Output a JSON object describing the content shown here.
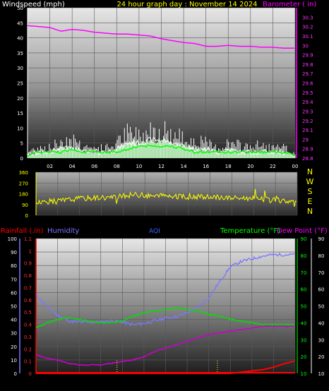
{
  "title": "24 hour graph day : November 14 2024",
  "colors": {
    "background": "#000000",
    "windspeed": "#ffffff",
    "windgust": "#ffffff",
    "wind_avg": "#00ff00",
    "wind_fill": "#bfffbf",
    "barometer": "#ff00ff",
    "direction": "#ffff00",
    "rainfall": "#ff0000",
    "humidity": "#7878ff",
    "temperature": "#00e000",
    "dewpoint": "#cc00cc",
    "aqi": "#0000ff",
    "grid": "#5a5a5a",
    "grid_label_white": "#ffffff",
    "grid_label_green": "#00ff00"
  },
  "labels": {
    "windspeed": "Windspeed (mph)",
    "barometer": "Barometer ( in)",
    "rainfall": "Rainfall (.in)",
    "humidity": "Humidity",
    "aqi": "AQI",
    "temperature": "Temperature (°F)",
    "dewpoint": "Dew Point (°F)"
  },
  "x_ticks": [
    "02",
    "04",
    "06",
    "08",
    "10",
    "12",
    "14",
    "16",
    "18",
    "20",
    "22",
    "00"
  ],
  "chart_data": [
    {
      "type": "line",
      "title": "24 hour graph day : November 14 2024",
      "xlabel": "",
      "x_ticks": [
        "02",
        "04",
        "06",
        "08",
        "10",
        "12",
        "14",
        "16",
        "18",
        "20",
        "22",
        "00"
      ],
      "left_axis": {
        "label": "Windspeed (mph)",
        "range": [
          0,
          50
        ],
        "ticks": [
          0,
          5,
          10,
          15,
          20,
          25,
          30,
          35,
          40,
          45,
          50
        ]
      },
      "right_axis": {
        "label": "Barometer ( in)",
        "range": [
          28.8,
          30.4
        ],
        "ticks": [
          "28.8",
          "28.9",
          "29",
          "29.1",
          "29.2",
          "29.3",
          "29.4",
          "29.5",
          "29.6",
          "29.7",
          "29.8",
          "29.9",
          "30",
          "30.1",
          "30.2",
          "30.3"
        ]
      },
      "series": [
        {
          "name": "Barometer",
          "axis": "right",
          "x": [
            0,
            1,
            2,
            3,
            4,
            5,
            6,
            7,
            8,
            9,
            10,
            11,
            12,
            13,
            14,
            15,
            16,
            17,
            18,
            19,
            20,
            21,
            22,
            23,
            24
          ],
          "values": [
            30.21,
            30.2,
            30.19,
            30.15,
            30.17,
            30.16,
            30.14,
            30.13,
            30.12,
            30.12,
            30.11,
            30.1,
            30.07,
            30.05,
            30.03,
            30.02,
            29.99,
            29.99,
            30.0,
            29.99,
            29.99,
            29.98,
            29.98,
            29.97,
            29.97
          ]
        },
        {
          "name": "Windgust",
          "axis": "left",
          "x": [
            0,
            1,
            2,
            3,
            4,
            5,
            6,
            7,
            8,
            9,
            10,
            11,
            12,
            13,
            14,
            15,
            16,
            17,
            18,
            19,
            20,
            21,
            22,
            23,
            24
          ],
          "values": [
            2,
            5,
            4,
            7,
            8,
            5,
            4,
            4,
            6,
            10,
            9,
            11,
            12,
            9,
            8,
            7,
            6,
            4,
            6,
            5,
            5,
            5,
            4,
            4,
            2
          ]
        },
        {
          "name": "Windspeed",
          "axis": "left",
          "x": [
            0,
            1,
            2,
            3,
            4,
            5,
            6,
            7,
            8,
            9,
            10,
            11,
            12,
            13,
            14,
            15,
            16,
            17,
            18,
            19,
            20,
            21,
            22,
            23,
            24
          ],
          "values": [
            1,
            2,
            2,
            3,
            4,
            2,
            2,
            2,
            3,
            5,
            5,
            6,
            6,
            5,
            4,
            3,
            3,
            2,
            3,
            2,
            2,
            2,
            2,
            2,
            1
          ]
        },
        {
          "name": "Windspeed avg",
          "axis": "left",
          "x": [
            0,
            1,
            2,
            3,
            4,
            5,
            6,
            7,
            8,
            9,
            10,
            11,
            12,
            13,
            14,
            15,
            16,
            17,
            18,
            19,
            20,
            21,
            22,
            23,
            24
          ],
          "values": [
            1,
            2,
            2,
            2,
            3,
            2,
            2,
            2,
            2,
            3,
            4,
            4,
            4,
            4,
            3,
            2,
            2,
            2,
            2,
            2,
            2,
            2,
            2,
            2,
            1
          ]
        }
      ]
    },
    {
      "type": "line",
      "xlabel": "",
      "left_axis": {
        "range": [
          0,
          360
        ],
        "ticks": [
          0,
          90,
          180,
          270,
          360
        ]
      },
      "right_axis_labels": [
        "N",
        "W",
        "S",
        "E",
        "N"
      ],
      "series": [
        {
          "name": "Wind direction",
          "x": [
            0,
            1,
            2,
            3,
            4,
            5,
            6,
            7,
            8,
            9,
            10,
            11,
            12,
            13,
            14,
            15,
            16,
            17,
            18,
            19,
            20,
            21,
            22,
            23,
            24
          ],
          "values": [
            110,
            115,
            120,
            130,
            140,
            145,
            150,
            150,
            160,
            175,
            165,
            160,
            165,
            155,
            155,
            155,
            150,
            150,
            145,
            145,
            140,
            130,
            125,
            120,
            115
          ]
        }
      ]
    },
    {
      "type": "line",
      "xlabel": "",
      "left_axis_humidity": {
        "label": "Humidity",
        "range": [
          0,
          100
        ],
        "ticks": [
          0,
          10,
          20,
          30,
          40,
          50,
          60,
          70,
          80,
          90,
          100
        ]
      },
      "left_axis_rain": {
        "label": "Rainfall (.in)",
        "range": [
          0,
          1.1
        ],
        "ticks": [
          "0",
          "0.1",
          "0.2",
          "0.3",
          "0.4",
          "0.5",
          "0.6",
          "0.7",
          "0.8",
          "0.9",
          "1",
          "1.1"
        ]
      },
      "right_axis": {
        "label": "Temperature (°F)",
        "range": [
          10,
          90
        ],
        "ticks": [
          10,
          20,
          30,
          40,
          50,
          60,
          70,
          80,
          90
        ]
      },
      "series": [
        {
          "name": "Humidity",
          "axis": "humidity",
          "x": [
            0,
            1,
            2,
            3,
            4,
            5,
            6,
            7,
            8,
            9,
            10,
            11,
            12,
            13,
            14,
            15,
            16,
            17,
            18,
            19,
            20,
            21,
            22,
            23,
            24
          ],
          "values": [
            58,
            50,
            43,
            39,
            38,
            38,
            38,
            39,
            38,
            36,
            37,
            39,
            41,
            42,
            45,
            49,
            56,
            68,
            79,
            83,
            85,
            87,
            88,
            88,
            88
          ]
        },
        {
          "name": "Temperature",
          "axis": "temp",
          "x": [
            0,
            1,
            2,
            3,
            4,
            5,
            6,
            7,
            8,
            9,
            10,
            11,
            12,
            13,
            14,
            15,
            16,
            17,
            18,
            19,
            20,
            21,
            22,
            23,
            24
          ],
          "values": [
            37,
            40,
            42,
            43,
            42,
            41,
            40,
            40,
            41,
            44,
            46,
            47,
            48,
            49,
            48,
            47,
            45,
            44,
            42,
            41,
            40,
            39,
            39,
            39,
            39
          ]
        },
        {
          "name": "Dew Point",
          "axis": "temp",
          "x": [
            0,
            1,
            2,
            3,
            4,
            5,
            6,
            7,
            8,
            9,
            10,
            11,
            12,
            13,
            14,
            15,
            16,
            17,
            18,
            19,
            20,
            21,
            22,
            23,
            24
          ],
          "values": [
            21,
            19,
            18,
            16,
            15,
            15,
            15,
            16,
            17,
            18,
            20,
            23,
            25,
            27,
            29,
            31,
            33,
            34,
            35,
            36,
            37,
            38,
            38,
            38,
            38
          ]
        },
        {
          "name": "Rainfall",
          "axis": "rain",
          "x": [
            0,
            2,
            4,
            6,
            8,
            10,
            12,
            14,
            16,
            18,
            19,
            20,
            21,
            22,
            23,
            24
          ],
          "values": [
            0,
            0,
            0,
            0,
            0,
            0,
            0,
            0,
            0,
            0,
            0.01,
            0.02,
            0.03,
            0.05,
            0.08,
            0.1
          ]
        }
      ]
    }
  ]
}
